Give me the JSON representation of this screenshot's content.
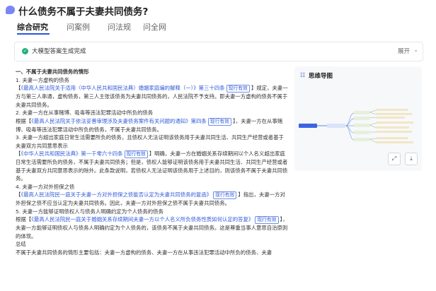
{
  "question": {
    "title": "什么债务不属于夫妻共同债务?"
  },
  "tabs": [
    {
      "label": "综合研究"
    },
    {
      "label": "问案例"
    },
    {
      "label": "问法规"
    },
    {
      "label": "问全网"
    }
  ],
  "status": {
    "text": "大模型答案生成完成",
    "expand_label": "展开"
  },
  "answer": {
    "heading": "一、不属于夫妻共同债务的情形",
    "s1_title": "1. 夫妻一方虚构的债务",
    "s1_link": "《最高人民法院关于适用〈中华人民共和国民法典〉婚姻家庭编的解释（一）》第三十四条",
    "s1_text": "规定，夫妻一方与第三人串通，虚构债务，第三人主张该债务为夫妻共同债务的，人民法院不予支持。即夫妻一方虚构的债务不属于夫妻共同债务。",
    "s2_title": "2. 夫妻一方在从事赌博、吸毒等违法犯罪活动中所负的债务",
    "s2_pre": "根据",
    "s2_link": "《最高人民法院关于依法妥善审理涉及夫妻债务案件有关问题的通知》第四条",
    "s2_text": "，夫妻一方在从事赌博、吸毒等违法犯罪活动中所负的债务，不属于夫妻共同债务。",
    "s3_title": "3. 夫妻一方超出家庭日常生活需要所负的债务，且债权人无法证明该债务用于夫妻共同生活、共同生产经营或者基于夫妻双方共同意思表示",
    "s3_link": "《中华人民共和国民法典》第一千零六十四条",
    "s3_text": "明确，夫妻一方在婚姻关系存续期间以个人名义超出家庭日常生活需要所负的债务，不属于夫妻共同债务；但是，债权人能够证明该债务用于夫妻共同生活、共同生产经营或者基于夫妻双方共同意思表示的除外。此条款说明，若债权人无法证明该债务用于上述目的，则该债务不属于夫妻共同债务。",
    "s4_title": "4. 夫妻一方对外担保之债",
    "s4_link": "《最高人民法院民一庭关于夫妻一方对外担保之债能否认定为夫妻共同债务的复函》",
    "s4_text": "指出，夫妻一方对外担保之债不应当认定为夫妻共同债务。因此，夫妻一方对外担保之债不属于夫妻共同债务。",
    "s5_title": "5. 夫妻一方能够证明债权人与债务人明确约定为个人债务的债务",
    "s5_pre": "根据",
    "s5_link": "《最高人民法院民一庭关于婚姻关系存续期间夫妻一方以个人名义所负债务性质如何认定的答复》",
    "s5_text": "，夫妻一方能够证明债权人与债务人明确约定为个人债务的，该债务不属于夫妻共同债务。这是尊重当事人意思自治原则的体现。",
    "summary_title": "总结",
    "summary_text": "不属于夫妻共同债务的情形主要包括：夫妻一方虚构的债务、夫妻一方在从事违法犯罪活动中所负的债务、夫妻",
    "badge": "现行有效"
  },
  "mindmap": {
    "title": "思维导图",
    "icon": "mindmap-icon"
  },
  "colors": {
    "accent": "#2a55e5",
    "success": "#22b07d",
    "link": "#2f5bd8"
  }
}
